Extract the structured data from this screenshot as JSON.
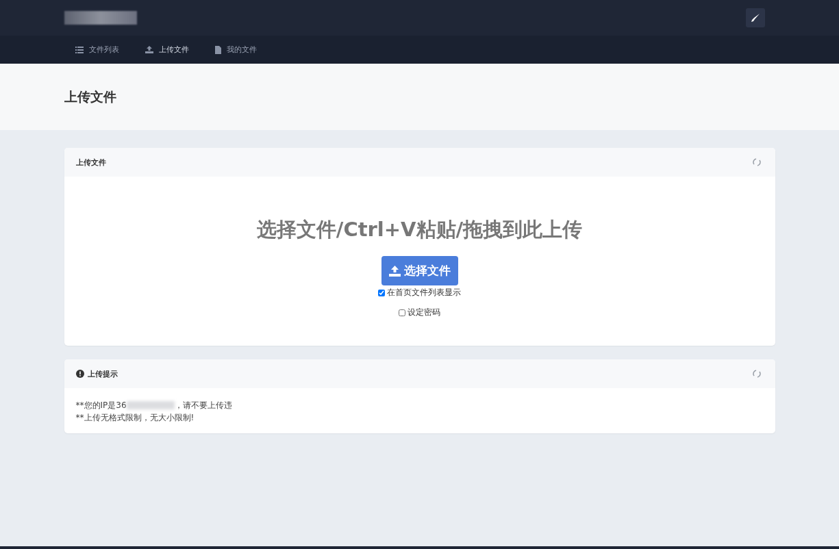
{
  "nav": {
    "items": [
      {
        "label": "文件列表",
        "selected": false
      },
      {
        "label": "上传文件",
        "selected": true
      },
      {
        "label": "我的文件",
        "selected": false
      }
    ]
  },
  "page_title": "上传文件",
  "upload_card": {
    "title": "上传文件",
    "headline": "选择文件/Ctrl+V粘贴/拖拽到此上传",
    "button": "选择文件",
    "options": [
      {
        "label": "在首页文件列表显示",
        "checked": true
      },
      {
        "label": "设定密码",
        "checked": false
      }
    ]
  },
  "tips_card": {
    "title": "上传提示",
    "lines": [
      {
        "parts": [
          "**您的IP是36",
          "，请不要上传违"
        ]
      },
      {
        "parts": [
          "**上传无格式限制，无大小限制!"
        ]
      }
    ]
  }
}
